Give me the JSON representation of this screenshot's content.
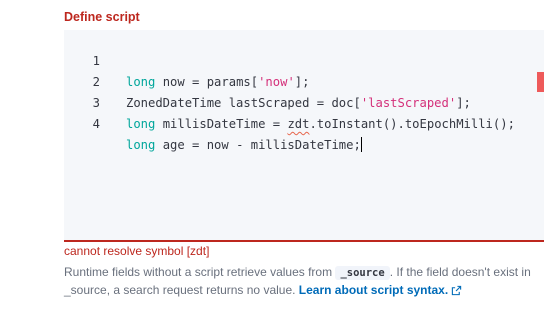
{
  "field": {
    "label": "Define script",
    "error": "cannot resolve symbol [zdt]"
  },
  "editor": {
    "lines": [
      {
        "num": "1",
        "t1": "long",
        "t2": " now = params[",
        "t3": "'now'",
        "t4": "];"
      },
      {
        "num": "2",
        "t1": "ZonedDateTime lastScraped = doc[",
        "t2": "'lastScraped'",
        "t3": "];"
      },
      {
        "num": "3",
        "t1": "long",
        "t2": " millisDateTime = ",
        "t3": "zdt",
        "t4": ".toInstant().toEpochMilli();"
      },
      {
        "num": "4",
        "t1": "long",
        "t2": " age = now - millisDateTime;"
      }
    ]
  },
  "help": {
    "part1": "Runtime fields without a script retrieve values from ",
    "code": "_source",
    "part2": ". If the field doesn't exist in _source, a search request returns no value. ",
    "link": "Learn about script syntax.",
    "link_icon": "external-link-icon"
  },
  "colors": {
    "danger": "#bd271e",
    "keyword": "#00a69b",
    "string": "#d4307a",
    "link": "#006bb8"
  }
}
